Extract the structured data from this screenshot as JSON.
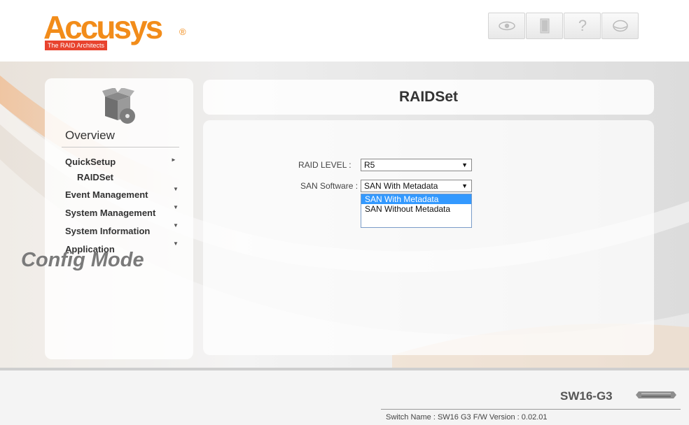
{
  "header": {
    "logo_text": "Accusys",
    "logo_reg": "®",
    "logo_tagline": "The RAID Architects",
    "icons": [
      "eye-icon",
      "door-icon",
      "help-icon",
      "disk-icon"
    ]
  },
  "sidebar": {
    "overview": "Overview",
    "items": [
      {
        "label": "QuickSetup",
        "sub": [
          "RAIDSet"
        ]
      },
      {
        "label": "Event Management"
      },
      {
        "label": "System Management"
      },
      {
        "label": "System Information"
      },
      {
        "label": "Application"
      }
    ],
    "mode_label": "Config Mode"
  },
  "main": {
    "title": "RAIDSet",
    "raid_level_label": "RAID LEVEL :",
    "raid_level_value": "R5",
    "san_software_label": "SAN Software :",
    "san_software_value": "SAN With Metadata",
    "san_options": [
      "SAN With Metadata",
      "SAN Without Metadata"
    ],
    "san_selected_index": 0
  },
  "footer": {
    "model": "SW16-G3",
    "info": "Switch Name : SW16 G3 F/W Version : 0.02.01"
  },
  "colors": {
    "brand_orange": "#f28c1a",
    "brand_red": "#e8432e",
    "selection_blue": "#3399ff"
  }
}
